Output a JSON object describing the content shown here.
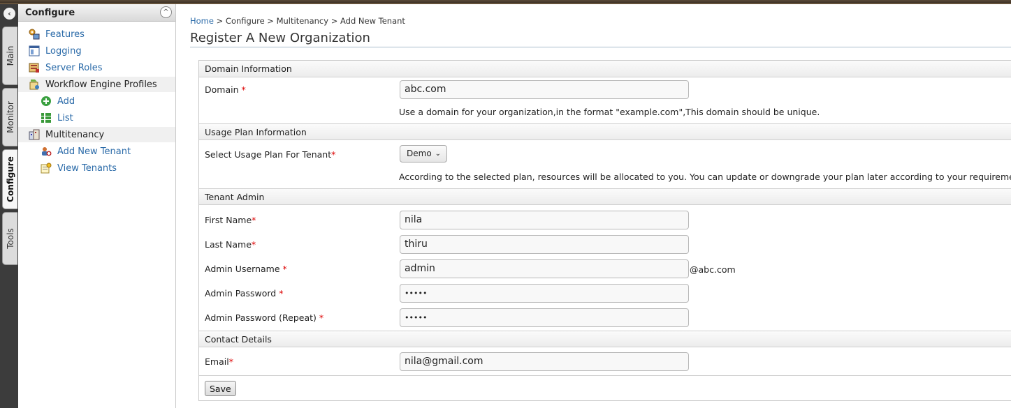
{
  "vtabs": [
    {
      "label": "Main"
    },
    {
      "label": "Monitor"
    },
    {
      "label": "Configure"
    },
    {
      "label": "Tools"
    }
  ],
  "sidebar": {
    "title": "Configure",
    "items": [
      {
        "label": "Features"
      },
      {
        "label": "Logging"
      },
      {
        "label": "Server Roles"
      },
      {
        "label": "Workflow Engine Profiles"
      },
      {
        "label": "Add"
      },
      {
        "label": "List"
      },
      {
        "label": "Multitenancy"
      },
      {
        "label": "Add New Tenant"
      },
      {
        "label": "View Tenants"
      }
    ]
  },
  "breadcrumb": {
    "home": "Home",
    "rest": " > Configure > Multitenancy > Add New Tenant"
  },
  "page_title": "Register A New Organization",
  "form": {
    "domain_section": "Domain Information",
    "domain_label": "Domain",
    "domain_value": "abc.com",
    "domain_hint": "Use a domain for your organization,in the format \"example.com\",This domain should be unique.",
    "usage_section": "Usage Plan Information",
    "usage_label": "Select Usage Plan For Tenant",
    "usage_value": "Demo",
    "usage_hint": "According to the selected plan, resources will be allocated to you. You can update or downgrade your plan later according to your requirements.",
    "admin_section": "Tenant Admin",
    "first_name_label": "First Name",
    "first_name_value": "nila",
    "last_name_label": "Last Name",
    "last_name_value": "thiru",
    "username_label": "Admin Username",
    "username_value": "admin",
    "username_suffix": "@abc.com",
    "password_label": "Admin Password",
    "password_value": "•••••",
    "password_repeat_label": "Admin Password (Repeat)",
    "password_repeat_value": "•••••",
    "contact_section": "Contact Details",
    "email_label": "Email",
    "email_value": "nila@gmail.com",
    "required_mark": "*",
    "save_label": "Save"
  },
  "icons": {
    "collapse": "‹",
    "sidebar_up": "^",
    "select_chevron": "⌄"
  }
}
